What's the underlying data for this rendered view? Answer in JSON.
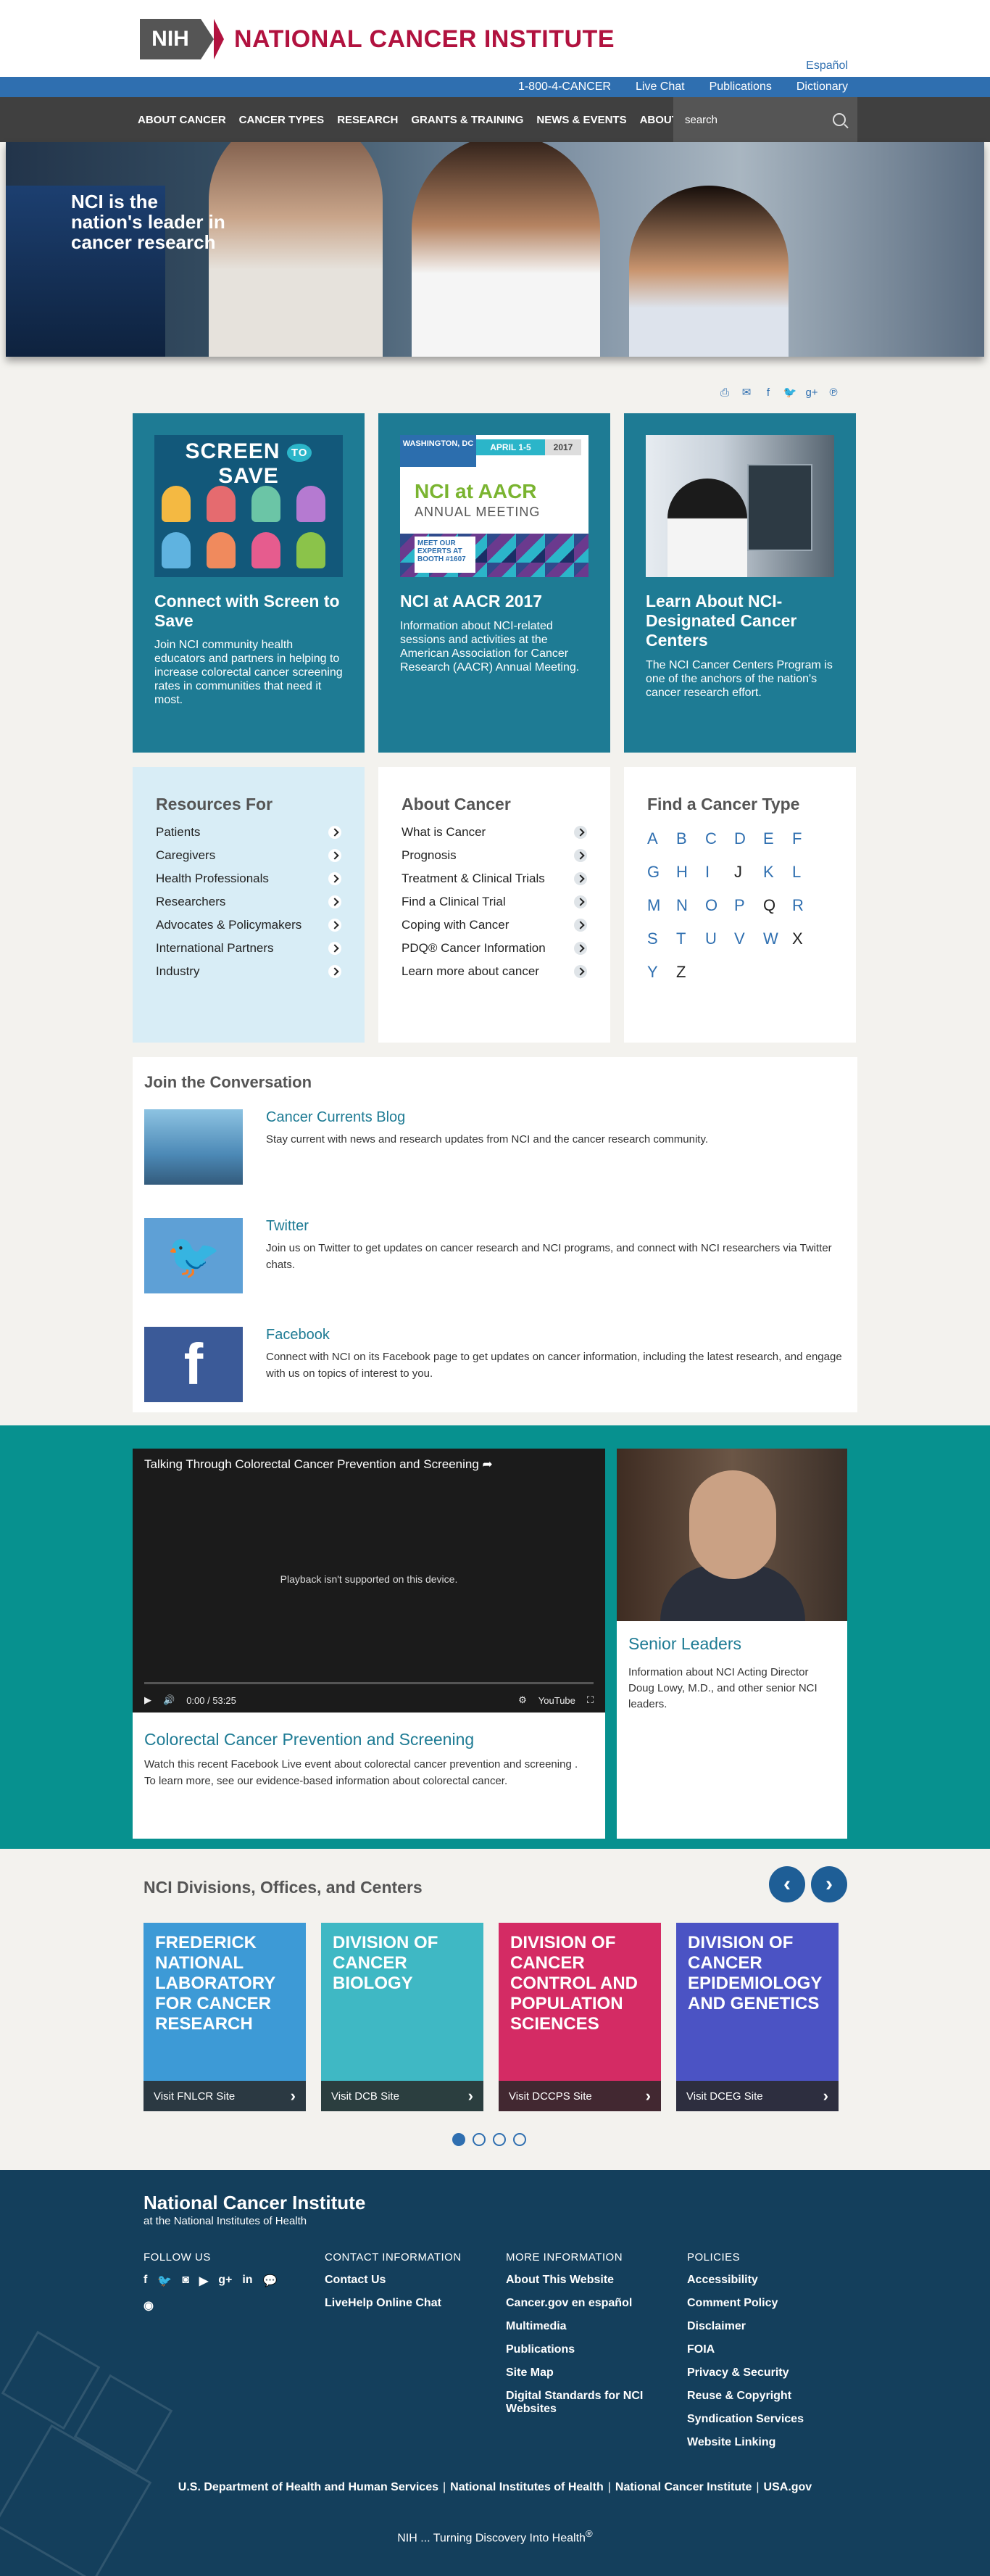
{
  "header": {
    "nih": "NIH",
    "site_name": "NATIONAL CANCER INSTITUTE",
    "espanol": "Español",
    "utility": [
      "1-800-4-CANCER",
      "Live Chat",
      "Publications",
      "Dictionary"
    ],
    "nav": [
      "ABOUT CANCER",
      "CANCER TYPES",
      "RESEARCH",
      "GRANTS & TRAINING",
      "NEWS & EVENTS",
      "ABOUT NCI"
    ],
    "search_placeholder": "search"
  },
  "hero": {
    "text": "NCI is the nation's leader in cancer research"
  },
  "share_icons": [
    "print-icon",
    "email-icon",
    "facebook-icon",
    "twitter-icon",
    "googleplus-icon",
    "pinterest-icon"
  ],
  "features": [
    {
      "image_title": "SCREEN",
      "image_to": "TO",
      "image_title2": "SAVE",
      "title": "Connect with Screen to Save",
      "text": "Join NCI community health educators and partners in helping to increase colorectal cancer screening rates in communities that need it most."
    },
    {
      "tag1": "WASHINGTON, DC",
      "tag2": "APRIL 1-5",
      "tag3": "2017",
      "big": "NCI at AACR",
      "sub": "ANNUAL MEETING",
      "meet": "MEET OUR EXPERTS AT BOOTH #1607",
      "title": "NCI at AACR 2017",
      "text": "Information about NCI-related sessions and activities at the American Association for Cancer Research (AACR) Annual Meeting."
    },
    {
      "title": "Learn About NCI-Designated Cancer Centers",
      "text": "The NCI Cancer Centers Program is one of the anchors of the nation's cancer research effort."
    }
  ],
  "resources": {
    "title": "Resources For",
    "items": [
      "Patients",
      "Caregivers",
      "Health Professionals",
      "Researchers",
      "Advocates & Policymakers",
      "International Partners",
      "Industry"
    ]
  },
  "about": {
    "title": "About Cancer",
    "items": [
      "What is Cancer",
      "Prognosis",
      "Treatment & Clinical Trials",
      "Find a Clinical Trial",
      "Coping with Cancer",
      "PDQ® Cancer Information",
      "Learn more about cancer"
    ]
  },
  "cancer_type": {
    "title": "Find a Cancer Type",
    "letters": [
      "A",
      "B",
      "C",
      "D",
      "E",
      "F",
      "G",
      "H",
      "I",
      "J",
      "K",
      "L",
      "M",
      "N",
      "O",
      "P",
      "Q",
      "R",
      "S",
      "T",
      "U",
      "V",
      "W",
      "X",
      "Y",
      "Z"
    ],
    "inactive": [
      "J",
      "Q",
      "X",
      "Z"
    ]
  },
  "conversation": {
    "title": "Join the Conversation",
    "items": [
      {
        "title": "Cancer Currents Blog",
        "text": "Stay current with news and research updates from NCI and the cancer research community."
      },
      {
        "title": "Twitter",
        "text": "Join us on Twitter to get updates on cancer research and NCI programs, and connect with NCI researchers via Twitter chats."
      },
      {
        "title": "Facebook",
        "text": "Connect with NCI on its Facebook page to get updates on cancer information, including the latest research, and engage with us on topics of interest to you."
      }
    ]
  },
  "video": {
    "player_title": "Talking Through Colorectal Cancer Prevention and Screening",
    "player_message": "Playback isn't supported on this device.",
    "time": "0:00 / 53:25",
    "youtube": "YouTube",
    "title": "Colorectal Cancer Prevention and Screening",
    "text": "Watch this recent Facebook Live event about colorectal cancer prevention and screening . To learn more, see our evidence-based information about colorectal cancer."
  },
  "leaders": {
    "title": "Senior Leaders",
    "text": "Information about NCI Acting Director Doug Lowy, M.D., and other senior NCI leaders."
  },
  "divisions": {
    "title": "NCI Divisions, Offices, and Centers",
    "cards": [
      {
        "title": "FREDERICK NATIONAL LABORATORY FOR CANCER RESEARCH",
        "link": "Visit FNLCR Site",
        "color": "#3d9ad6"
      },
      {
        "title": "DIVISION OF CANCER BIOLOGY",
        "link": "Visit DCB Site",
        "color": "#3fb8c4"
      },
      {
        "title": "DIVISION OF CANCER CONTROL AND POPULATION SCIENCES",
        "link": "Visit DCCPS Site",
        "color": "#d42b64"
      },
      {
        "title": "DIVISION OF CANCER EPIDEMIOLOGY AND GENETICS",
        "link": "Visit DCEG Site",
        "color": "#4b53c4"
      }
    ],
    "active_page": 1,
    "pages": 4
  },
  "footer": {
    "name": "National Cancer Institute",
    "sub": "at the National Institutes of Health",
    "follow": {
      "title": "FOLLOW US",
      "icons": [
        "f",
        "t",
        "ig",
        "yt",
        "g+",
        "in",
        "chat",
        "rss"
      ]
    },
    "contact": {
      "title": "CONTACT INFORMATION",
      "links": [
        "Contact Us",
        "LiveHelp Online Chat"
      ]
    },
    "more": {
      "title": "MORE INFORMATION",
      "links": [
        "About This Website",
        "Cancer.gov en español",
        "Multimedia",
        "Publications",
        "Site Map",
        "Digital Standards for NCI Websites"
      ]
    },
    "policies": {
      "title": "POLICIES",
      "links": [
        "Accessibility",
        "Comment Policy",
        "Disclaimer",
        "FOIA",
        "Privacy & Security",
        "Reuse & Copyright",
        "Syndication Services",
        "Website Linking"
      ]
    },
    "bottom": [
      "U.S. Department of Health and Human Services",
      "National Institutes of Health",
      "National Cancer Institute",
      "USA.gov"
    ],
    "tagline": "NIH ... Turning Discovery Into Health",
    "reg": "®"
  }
}
